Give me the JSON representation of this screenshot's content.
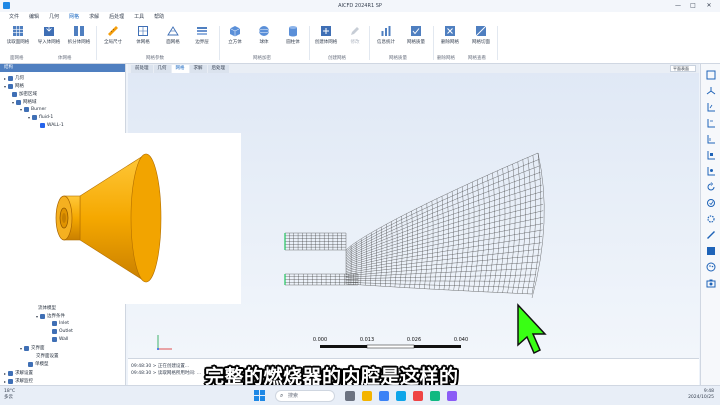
{
  "window": {
    "title": "AICFD 2024R1 SP",
    "controls": [
      "—",
      "□",
      "✕"
    ]
  },
  "menu": [
    "文件",
    "编辑",
    "几何",
    "网格",
    "求解",
    "后处理",
    "工具",
    "帮助"
  ],
  "ribbon": {
    "buttons": [
      {
        "label": "读取面网格"
      },
      {
        "label": "导入体网格"
      },
      {
        "label": "拆分体网格"
      },
      {
        "label": "全局尺寸"
      },
      {
        "label": "体网格"
      },
      {
        "label": "面网格"
      },
      {
        "label": "边界层"
      },
      {
        "label": "立方体"
      },
      {
        "label": "球体"
      },
      {
        "label": "圆柱体"
      },
      {
        "label": "创建体网格"
      },
      {
        "label": "修改"
      },
      {
        "label": "信息统计"
      },
      {
        "label": "网格质量"
      },
      {
        "label": "删除网格"
      },
      {
        "label": "网格切面"
      }
    ],
    "groups": [
      "面网格",
      "体网格",
      "网格参数",
      "网格加密",
      "创建网格",
      "网格质量",
      "删除网格",
      "网格查看"
    ]
  },
  "tree": {
    "header": "结构",
    "nodes": [
      "几何",
      "网格",
      "加密区域",
      "网格域",
      "Burner",
      "fluid-1",
      "WALL-1",
      "流体模型",
      "边界条件",
      "Inlet",
      "Outlet",
      "Wall",
      "交界面",
      "交界面设置",
      "单模型",
      "求解设置",
      "求解监控"
    ]
  },
  "tabs": [
    "前处理",
    "几何",
    "网格",
    "求解",
    "后处理"
  ],
  "viewport": {
    "view_select": "平面表面",
    "scale": {
      "ticks": [
        "0.000",
        "0.013",
        "0.026",
        "0.040"
      ]
    }
  },
  "console": {
    "lines": [
      "09:48:30 > 正在创建设置...",
      "09:48:30 > 读取网格所用时间: ..."
    ]
  },
  "subtitle": "完整的燃烧器的内腔是这样的",
  "taskbar": {
    "weather_temp": "18°C",
    "weather_desc": "多云",
    "search": "搜索",
    "time": "9:48",
    "date": "2024/10/25"
  },
  "colors": {
    "accent": "#1565c0",
    "cone": "#f5a800",
    "mesh": "#3a3a3a",
    "cursor_fill": "#39ff14"
  }
}
